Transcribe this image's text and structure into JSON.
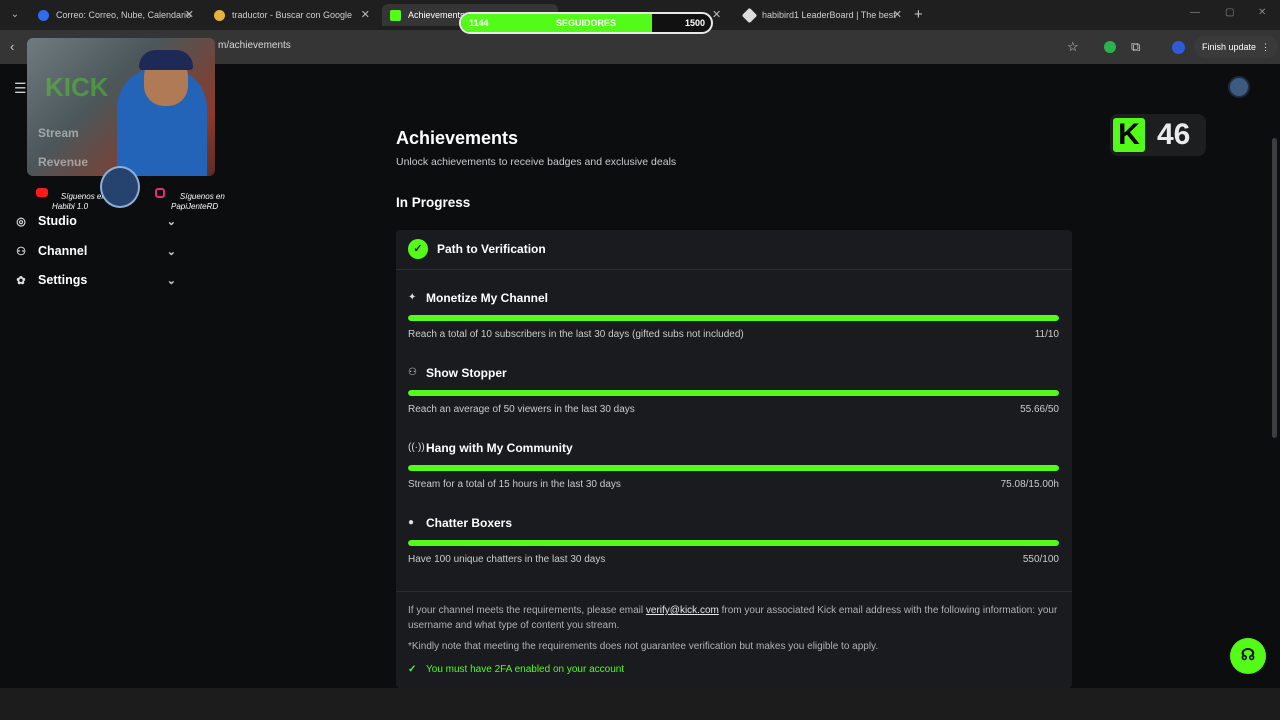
{
  "browser": {
    "tabs": [
      {
        "title": "Correo: Correo, Nube, Calendario",
        "color": "#2f6cf0"
      },
      {
        "title": "traductor - Buscar con Google",
        "color": "#e8b33a"
      },
      {
        "title": "Achievements",
        "color": "#53fc18"
      },
      {
        "title": "habibird1 LeaderBoard | The best",
        "color": "#dddddd"
      }
    ],
    "url": "m/achievements",
    "finish_update": "Finish update"
  },
  "overlay": {
    "followers_current": "1144",
    "followers_label": "SEGUIDORES",
    "followers_goal": "1500",
    "followers_fraction": 0.763,
    "kick_count": "46",
    "social_left": "Síguenos en\nHabibi 1.0",
    "social_right": "Síguenos en\nPapiJenteRD",
    "ghost_stream": "Stream",
    "ghost_revenue": "Revenue",
    "ghost_kick": "KICK"
  },
  "sidebar": {
    "items": [
      {
        "label": "Studio",
        "icon": "studio-icon"
      },
      {
        "label": "Channel",
        "icon": "channel-icon"
      },
      {
        "label": "Settings",
        "icon": "gear-icon"
      }
    ]
  },
  "main": {
    "title": "Achievements",
    "subtitle": "Unlock achievements to receive badges and exclusive deals",
    "section_title": "In Progress",
    "card_title": "Path to Verification",
    "goals": [
      {
        "icon": "sparkle-icon",
        "title": "Monetize My Channel",
        "desc": "Reach a total of 10 subscribers in the last 30 days (gifted subs not included)",
        "value": "11/10",
        "progress": 1.0
      },
      {
        "icon": "viewers-icon",
        "title": "Show Stopper",
        "desc": "Reach an average of 50 viewers in the last 30 days",
        "value": "55.66/50",
        "progress": 1.0
      },
      {
        "icon": "broadcast-icon",
        "title": "Hang with My Community",
        "desc": "Stream for a total of 15 hours in the last 30 days",
        "value": "75.08/15.00h",
        "progress": 1.0
      },
      {
        "icon": "chat-icon",
        "title": "Chatter Boxers",
        "desc": "Have 100 unique chatters in the last 30 days",
        "value": "550/100",
        "progress": 1.0
      }
    ],
    "note_pre": "If your channel meets the requirements, please email ",
    "note_email": "verify@kick.com",
    "note_post": " from your associated Kick email address with the following information: your username and what type of content you stream.",
    "note_disclaimer": "*Kindly note that meeting the requirements does not guarantee verification but makes you eligible to apply.",
    "twofa": "You must have 2FA enabled on your account"
  },
  "colors": {
    "accent": "#53fc18",
    "background": "#0b0d0e",
    "card": "#191b1f"
  }
}
